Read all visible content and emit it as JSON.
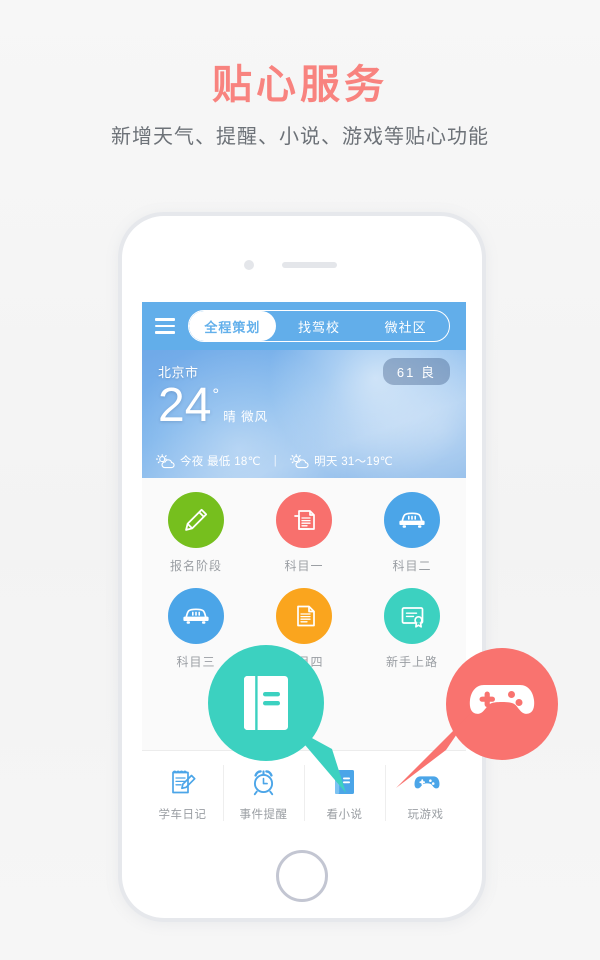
{
  "promo": {
    "headline": "贴心服务",
    "subhead": "新增天气、提醒、小说、游戏等贴心功能",
    "headline_color": "#f8837f",
    "subhead_color": "#6d7278"
  },
  "app": {
    "topbar": {
      "menu_icon": "hamburger-menu-icon",
      "tabs": [
        {
          "label": "全程策划",
          "active": true
        },
        {
          "label": "找驾校",
          "active": false
        },
        {
          "label": "微社区",
          "active": false
        }
      ],
      "bg_color": "#62aeea"
    },
    "weather": {
      "city": "北京市",
      "aqi": "61 良",
      "temperature": "24",
      "degree_symbol": "°",
      "condition": "晴 微风",
      "tonight": {
        "icon": "sun-behind-cloud-icon",
        "text": "今夜 最低 18℃"
      },
      "tomorrow": {
        "icon": "sun-behind-cloud-icon",
        "text": "明天 31～19℃"
      },
      "separator": "|"
    },
    "grid": {
      "rows": [
        [
          {
            "label": "报名阶段",
            "icon": "pencil-icon",
            "color": "#76bf1e"
          },
          {
            "label": "科目一",
            "icon": "document-icon",
            "color": "#f8706d"
          },
          {
            "label": "科目二",
            "icon": "car-icon",
            "color": "#4ba5e8"
          }
        ],
        [
          {
            "label": "科目三",
            "icon": "car-icon",
            "color": "#4ba5e8"
          },
          {
            "label": "科目四",
            "icon": "document-icon",
            "color": "#faa51e"
          },
          {
            "label": "新手上路",
            "icon": "certificate-icon",
            "color": "#3cd1c0"
          }
        ]
      ]
    },
    "bottom_nav": [
      {
        "label": "学车日记",
        "icon": "notebook-pen-icon",
        "color": "#4ba5e8"
      },
      {
        "label": "事件提醒",
        "icon": "alarm-clock-icon",
        "color": "#4ba5e8"
      },
      {
        "label": "看小说",
        "icon": "book-icon",
        "color": "#4ba5e8"
      },
      {
        "label": "玩游戏",
        "icon": "gamepad-icon",
        "color": "#4ba5e8"
      }
    ]
  },
  "callouts": [
    {
      "name": "novel-callout",
      "icon": "book-icon",
      "color": "#3cd1c0",
      "points_to": "看小说"
    },
    {
      "name": "game-callout",
      "icon": "gamepad-icon",
      "color": "#f9736f",
      "points_to": "玩游戏"
    }
  ],
  "device": {
    "camera": "camera-dot",
    "speaker": "speaker-grille",
    "home_button": "home-button"
  }
}
